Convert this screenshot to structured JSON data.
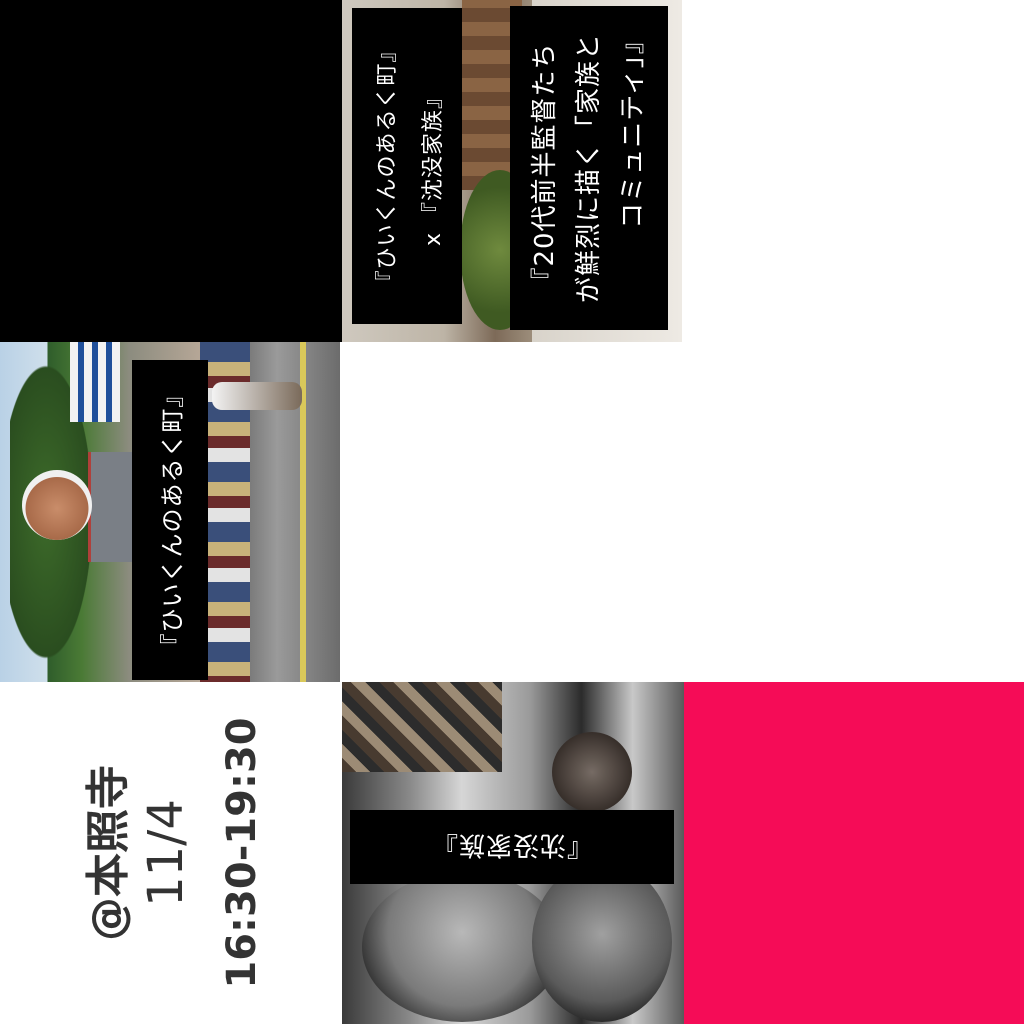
{
  "panels": {
    "title": {
      "line1": "『ひいくんのあるく町』",
      "line2": "x 『沈没家族』"
    },
    "tagline": {
      "line1": "『20代前半監督たち",
      "line2": "が鮮烈に描く「家族と",
      "line3": "コミュニティ」』"
    },
    "walk": {
      "caption": "『ひいくんのあるく町』"
    },
    "date": {
      "place": "@本照寺",
      "date": "11/4",
      "time": "16:30-19:30"
    },
    "family": {
      "caption": "『沈没家族』"
    }
  },
  "colors": {
    "accent": "#f50c57",
    "text_dark": "#333333",
    "label_bg": "#000000"
  }
}
